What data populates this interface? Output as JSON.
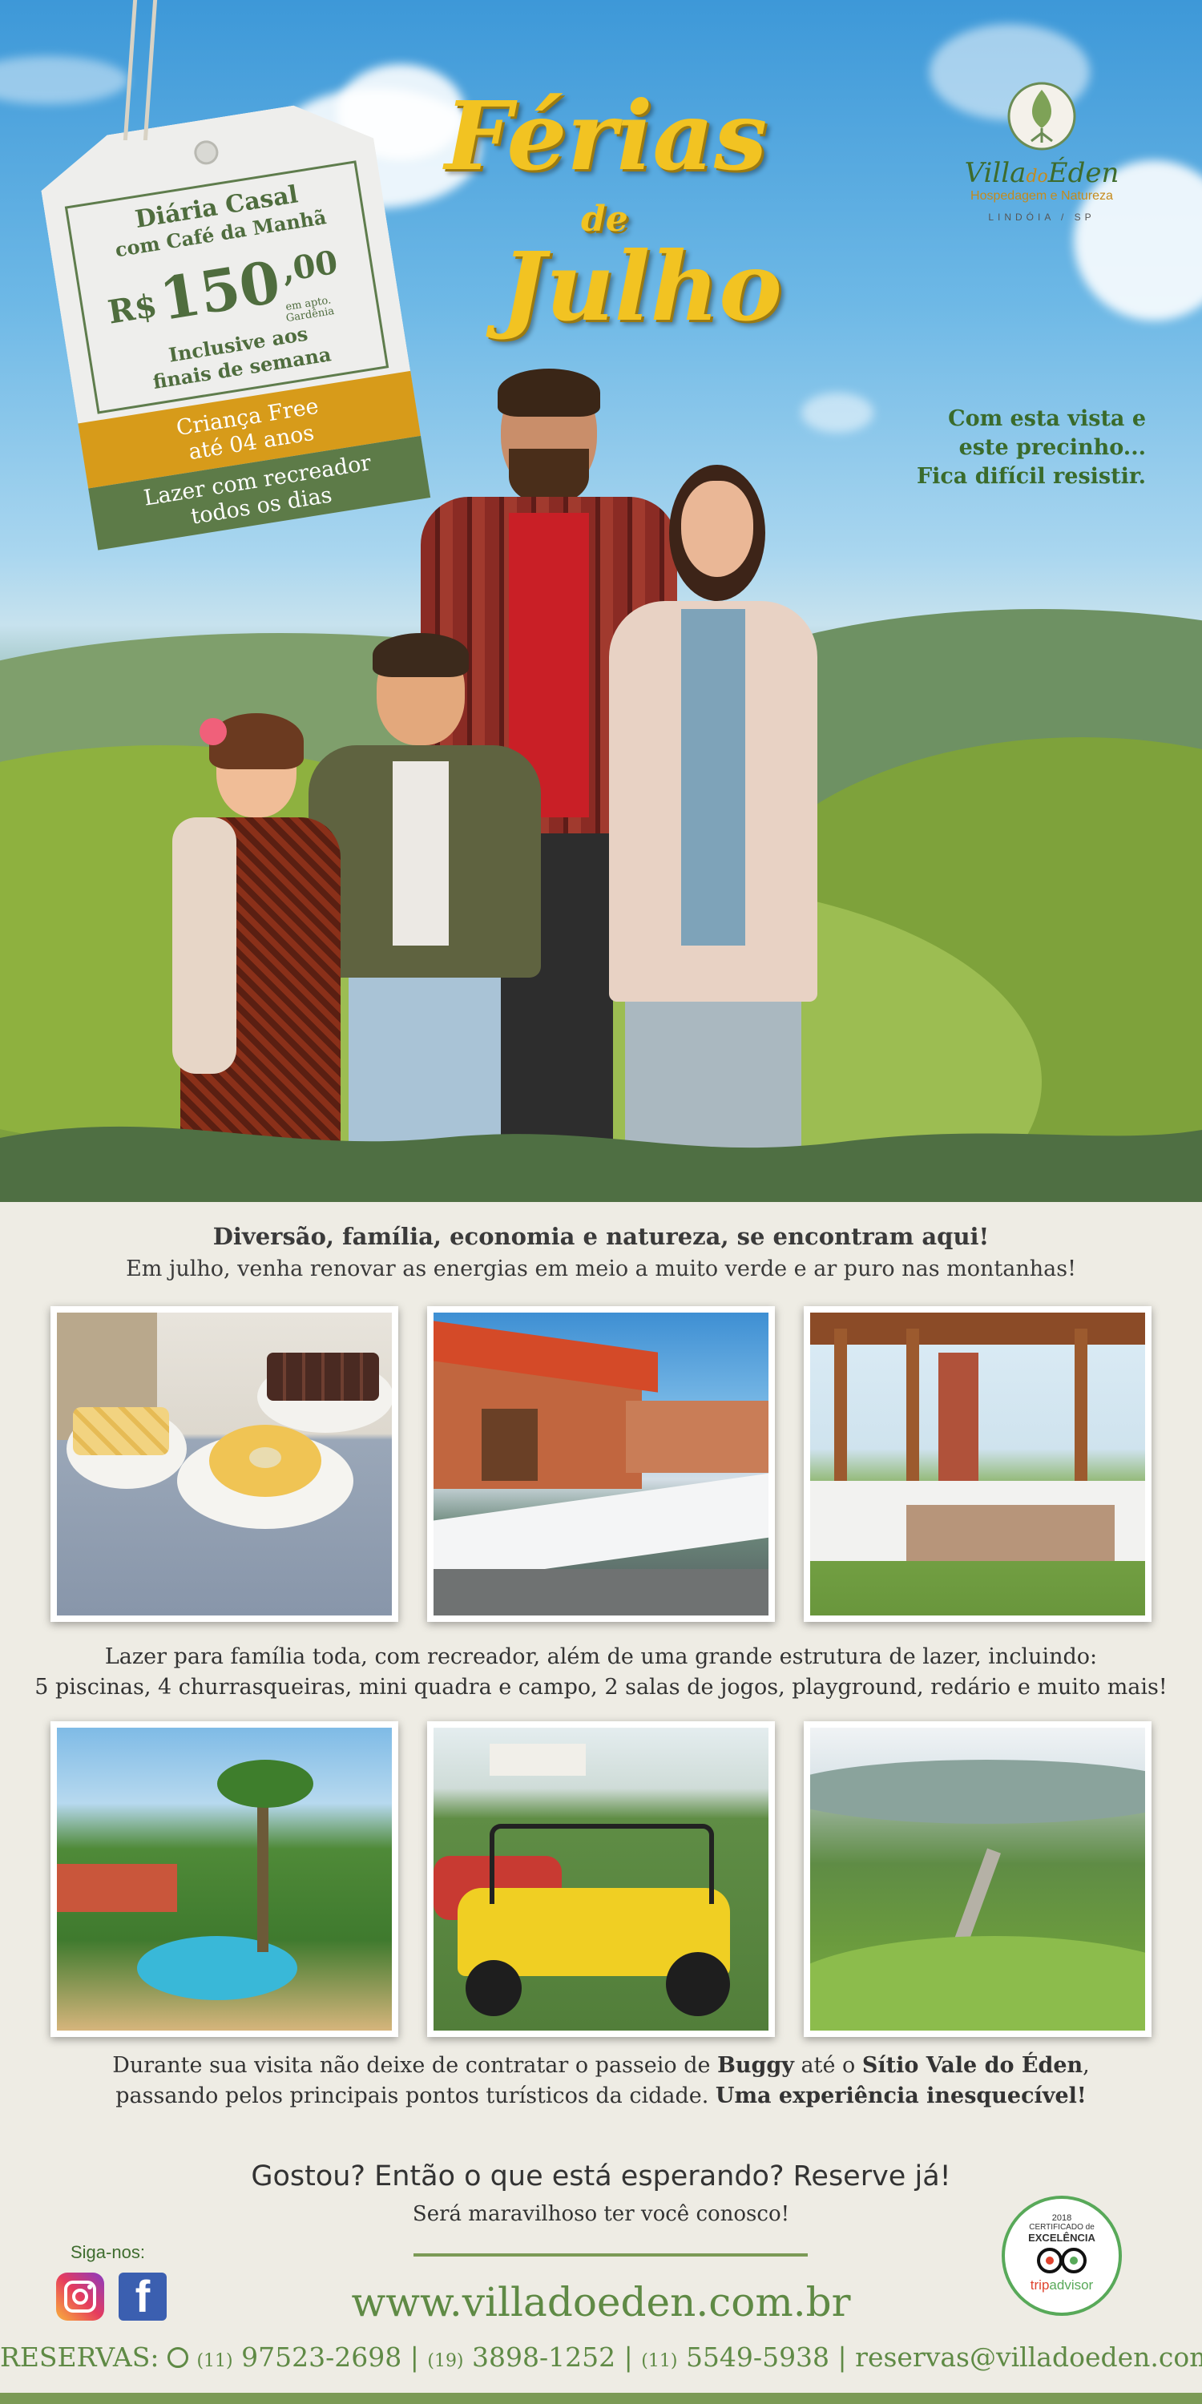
{
  "tag": {
    "line1": "Diária Casal",
    "line2": "com Café da Manhã",
    "currency": "R$",
    "amount": "150",
    "cents": ",00",
    "note1": "em apto.",
    "note2": "Gardênia",
    "line3": "Inclusive aos",
    "line4": "finais de semana",
    "band1_l1": "Criança Free",
    "band1_l2": "até 04 anos",
    "band2_l1": "Lazer com recreador",
    "band2_l2": "todos os dias"
  },
  "title": {
    "w1": "Férias",
    "w2": "de",
    "w3": "Julho"
  },
  "logo": {
    "name_a": "Villa",
    "name_b": "do",
    "name_c": "Éden",
    "sub": "Hospedagem e Natureza",
    "city": "LINDÓIA / SP"
  },
  "tagline": {
    "l1": "Com esta vista e",
    "l2": "este precinho...",
    "l3": "Fica difícil resistir."
  },
  "intro": {
    "heading": "Diversão, família, economia e natureza, se encontram aqui!",
    "body": "Em julho, venha renovar as energias em meio a muito verde e ar puro nas montanhas!"
  },
  "leisure": {
    "l1": "Lazer para família toda, com recreador, além de uma grande estrutura de lazer, incluindo:",
    "l2": "5 piscinas, 4 churrasqueiras, mini quadra e campo, 2 salas de jogos, playground, redário e muito mais!"
  },
  "buggy": {
    "a": "Durante sua visita não deixe de contratar o passeio de ",
    "b": "Buggy",
    "c": " até o ",
    "d": "Sítio Vale do Éden",
    "e": ",",
    "f": "passando pelos principais pontos turísticos da cidade. ",
    "g": "Uma experiência inesquecível!"
  },
  "cta": {
    "title": "Gostou? Então o que está esperando? Reserve já!",
    "sub": "Será maravilhoso ter você conosco!"
  },
  "social": {
    "label": "Siga-nos:",
    "icons": [
      "instagram-icon",
      "facebook-icon"
    ]
  },
  "website": "www.villadoeden.com.br",
  "tripadvisor": {
    "year": "2018",
    "l1": "CERTIFICADO de",
    "l2": "EXCELÊNCIA",
    "brand_a": "trip",
    "brand_b": "advisor"
  },
  "reservas": {
    "label": "RESERVAS:",
    "p1_ddd": "(11)",
    "p1": "97523-2698",
    "p2_ddd": "(19)",
    "p2": "3898-1252",
    "p3_ddd": "(11)",
    "p3": "5549-5938",
    "email": "reservas@villadoeden.com.br"
  },
  "colors": {
    "green": "#5d7b48",
    "gold": "#d79b1a",
    "title": "#f2c322",
    "bg": "#eeece4"
  }
}
